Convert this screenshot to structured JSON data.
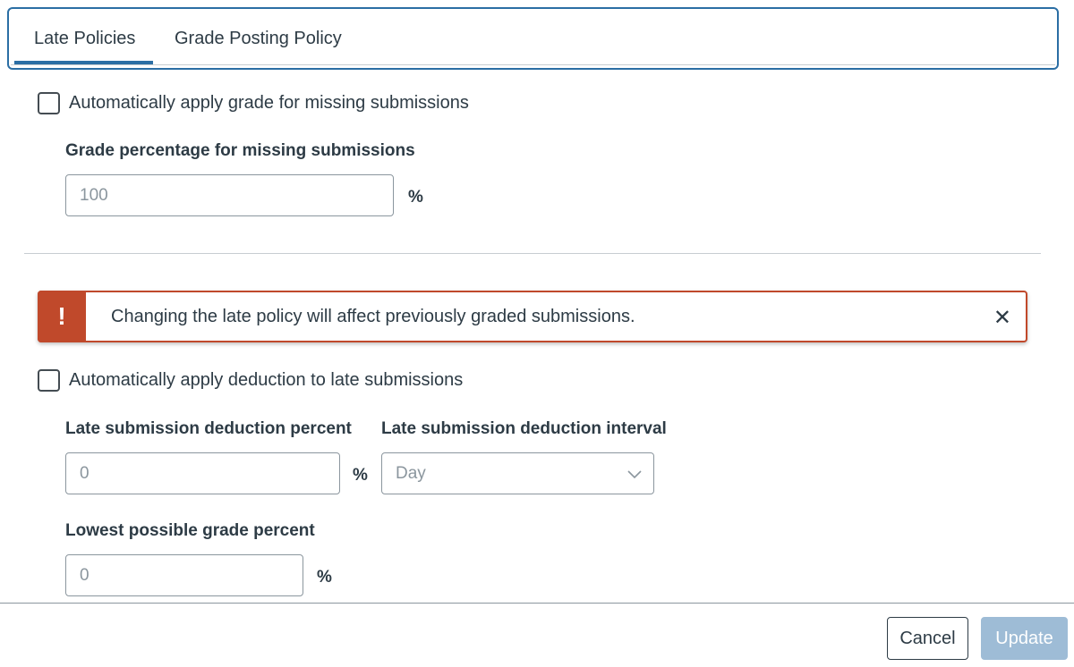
{
  "tabs": [
    {
      "label": "Late Policies"
    },
    {
      "label": "Grade Posting Policy"
    }
  ],
  "missing": {
    "checkbox_label": "Automatically apply grade for missing submissions",
    "grade_label": "Grade percentage for missing submissions",
    "grade_placeholder": "100",
    "grade_unit": "%"
  },
  "alert": {
    "badge": "!",
    "message": "Changing the late policy will affect previously graded submissions.",
    "close": "✕"
  },
  "late": {
    "checkbox_label": "Automatically apply deduction to late submissions",
    "deduction_label": "Late submission deduction percent",
    "deduction_placeholder": "0",
    "deduction_unit": "%",
    "interval_label": "Late submission deduction interval",
    "interval_value": "Day",
    "lowest_label": "Lowest possible grade percent",
    "lowest_placeholder": "0",
    "lowest_unit": "%"
  },
  "footer": {
    "cancel_label": "Cancel",
    "update_label": "Update"
  },
  "colors": {
    "accent": "#2b6ea4",
    "warning": "#c0492b",
    "disabled_button": "#9ebcd6"
  }
}
